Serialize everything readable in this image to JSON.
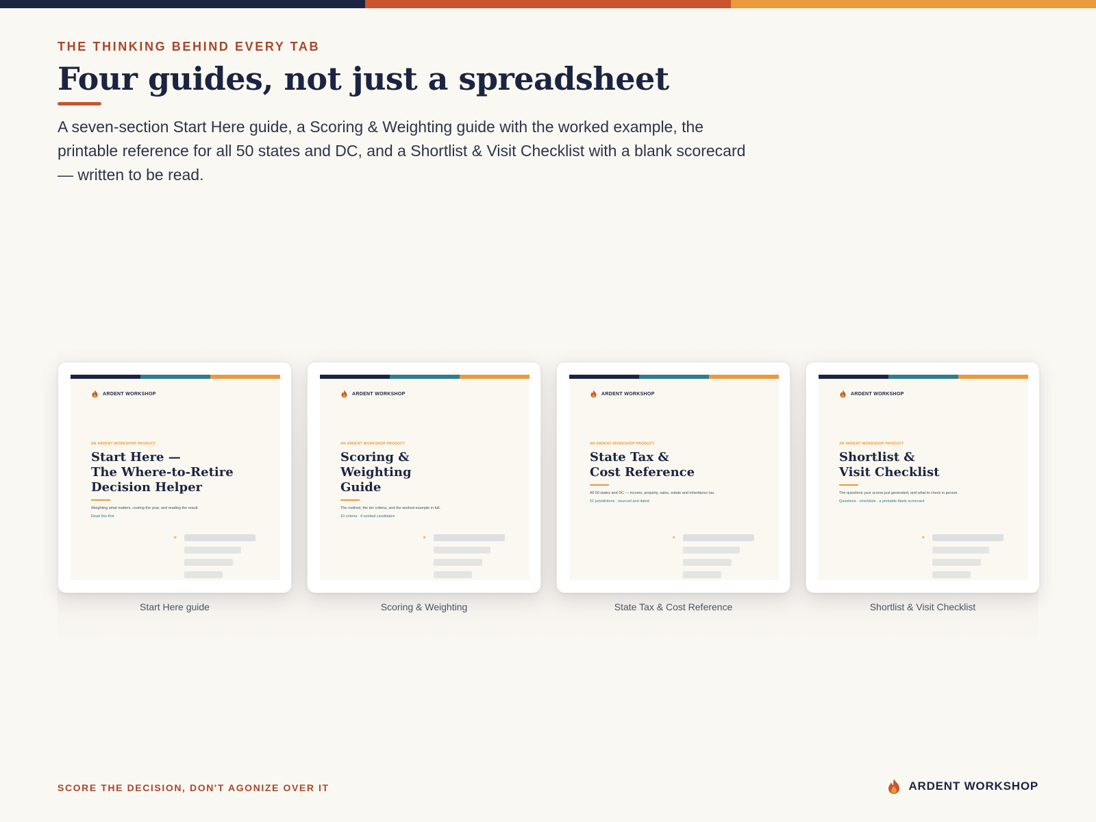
{
  "colors": {
    "navy": "#1b2440",
    "rust": "#c9552f",
    "orange": "#e99a3c",
    "teal": "#2f7d8c",
    "background": "#faf8f3"
  },
  "header": {
    "eyebrow": "THE THINKING BEHIND EVERY TAB",
    "title": "Four guides, not just a spreadsheet",
    "intro": "A seven-section Start Here guide, a Scoring & Weighting guide with the worked example, the printable reference for all 50 states and DC, and a Shortlist & Visit Checklist with a blank scorecard — written to be read."
  },
  "cards": [
    {
      "brand": "ARDENT WORKSHOP",
      "eyebrow": "AN ARDENT WORKSHOP PRODUCT",
      "title": "Start Here —\nThe Where-to-Retire\nDecision Helper",
      "subtitle": "Weighting what matters, costing the year, and reading the result.",
      "link": "Read this first",
      "caption": "Start Here guide",
      "icon": "flame-icon"
    },
    {
      "brand": "ARDENT WORKSHOP",
      "eyebrow": "AN ARDENT WORKSHOP PRODUCT",
      "title": "Scoring &\nWeighting\nGuide",
      "subtitle": "The method, the ten criteria, and the worked example in full.",
      "link": "10 criteria · 4 worked candidates",
      "caption": "Scoring & Weighting",
      "icon": "flame-icon"
    },
    {
      "brand": "ARDENT WORKSHOP",
      "eyebrow": "AN ARDENT WORKSHOP PRODUCT",
      "title": "State Tax &\nCost Reference",
      "subtitle": "All 50 states and DC — income, property, sales, estate and inheritance tax.",
      "link": "51 jurisdictions · sourced and dated",
      "caption": "State Tax & Cost Reference",
      "icon": "flame-icon"
    },
    {
      "brand": "ARDENT WORKSHOP",
      "eyebrow": "AN ARDENT WORKSHOP PRODUCT",
      "title": "Shortlist &\nVisit Checklist",
      "subtitle": "The questions your scores just generated, and what to check in person.",
      "link": "Questions · checklists · a printable blank scorecard",
      "caption": "Shortlist & Visit Checklist",
      "icon": "flame-icon"
    }
  ],
  "footer": {
    "tagline": "SCORE THE DECISION, DON'T AGONIZE OVER IT",
    "brand": "ARDENT WORKSHOP",
    "icon": "flame-icon"
  }
}
